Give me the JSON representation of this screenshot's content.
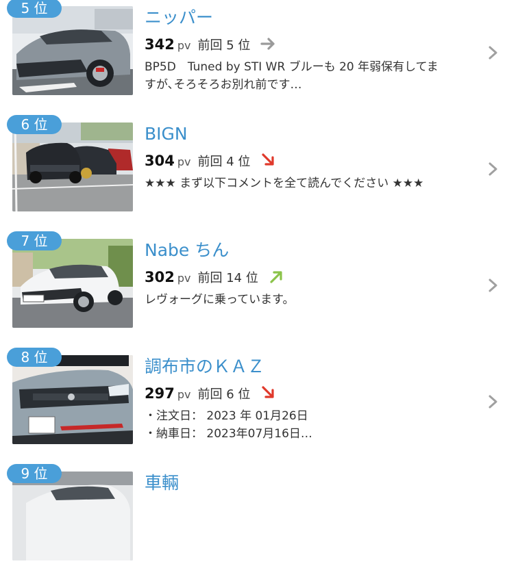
{
  "items": [
    {
      "rank": "5 位",
      "name": "ニッパー",
      "pv": "342",
      "pv_unit": "pv",
      "previous": "前回 5 位",
      "trend": "same",
      "description": [
        "BP5D　Tuned by STI WR ブルーも 20 年弱保有してま",
        "すが､そろそろお別れ前です…"
      ]
    },
    {
      "rank": "6 位",
      "name": "BIGN",
      "pv": "304",
      "pv_unit": "pv",
      "previous": "前回 4 位",
      "trend": "down",
      "description": [
        "★★★ まず以下コメントを全て読んでください ★★★"
      ]
    },
    {
      "rank": "7 位",
      "name": "Nabe ちん",
      "pv": "302",
      "pv_unit": "pv",
      "previous": "前回 14 位",
      "trend": "up",
      "description": [
        "レヴォーグに乗っています。"
      ]
    },
    {
      "rank": "8 位",
      "name": "調布市のＫＡＺ",
      "pv": "297",
      "pv_unit": "pv",
      "previous": "前回 6 位",
      "trend": "down",
      "description": [
        "・注文日：  2023 年 01月26日",
        "・納車日：  2023年07月16日…"
      ]
    },
    {
      "rank": "9 位",
      "name": "車輛",
      "pv": "",
      "pv_unit": "",
      "previous": "",
      "trend": "up",
      "description": []
    }
  ],
  "colors": {
    "badge": "#4a9fd9",
    "name": "#3b8fcb",
    "trend_same": "#9a9a9a",
    "trend_down": "#e0392b",
    "trend_up": "#8bc34a",
    "chevron": "#a0a0a0"
  },
  "icons": {
    "trend_same": "arrow-right-icon",
    "trend_down": "arrow-down-right-icon",
    "trend_up": "arrow-up-right-icon",
    "chevron": "chevron-right-icon"
  }
}
